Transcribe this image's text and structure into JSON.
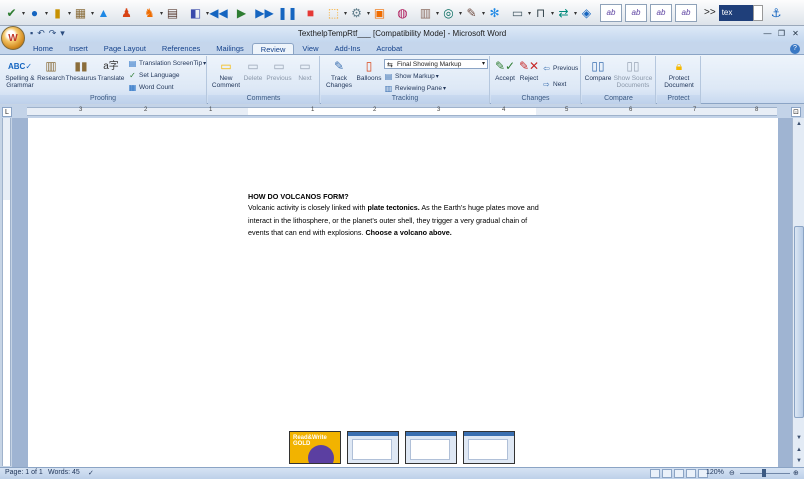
{
  "rw_toolbar": {
    "abc_buttons": [
      "ab",
      "ab",
      "ab",
      "ab"
    ],
    "more_label": ">>",
    "text_label": "tex"
  },
  "titlebar": {
    "title": "TexthelpTempRtf___ [Compatibility Mode] - Microsoft Word"
  },
  "tabs": [
    "Home",
    "Insert",
    "Page Layout",
    "References",
    "Mailings",
    "Review",
    "View",
    "Add-Ins",
    "Acrobat"
  ],
  "active_tab": "Review",
  "ribbon": {
    "proofing": {
      "label": "Proofing",
      "spelling": "Spelling &\nGrammar",
      "research": "Research",
      "thesaurus": "Thesaurus",
      "translate": "Translate",
      "translation_screentip": "Translation ScreenTip",
      "set_language": "Set Language",
      "word_count": "Word Count"
    },
    "comments": {
      "label": "Comments",
      "new_comment": "New\nComment",
      "delete": "Delete",
      "previous": "Previous",
      "next": "Next"
    },
    "tracking": {
      "label": "Tracking",
      "track_changes": "Track\nChanges",
      "balloons": "Balloons",
      "markup_select": "Final Showing Markup",
      "show_markup": "Show Markup",
      "reviewing_pane": "Reviewing Pane"
    },
    "changes": {
      "label": "Changes",
      "accept": "Accept",
      "reject": "Reject",
      "previous": "Previous",
      "next": "Next"
    },
    "compare": {
      "label": "Compare",
      "compare": "Compare",
      "show_source": "Show Source\nDocuments"
    },
    "protect": {
      "label": "Protect",
      "protect_document": "Protect\nDocument"
    }
  },
  "ruler": {
    "numbers": [
      "3",
      "2",
      "1",
      "1",
      "2",
      "3",
      "4",
      "5",
      "6",
      "7",
      "8",
      "9",
      "10",
      "11",
      "12"
    ]
  },
  "document": {
    "heading": "HOW DO VOLCANOS FORM?",
    "p1_a": "Volcanic activity is closely linked with ",
    "p1_bold": "plate tectonics.",
    "p1_b": " As the Earth’s huge plates move and interact in the lithosphere, or the planet’s outer shell, they trigger a very gradual chain of events that can end with explosions. ",
    "p1_bold2": "Choose a volcano above."
  },
  "thumbnails": {
    "rw_label": "Read&Write\nGOLD"
  },
  "statusbar": {
    "page": "Page: 1 of 1",
    "words": "Words: 45",
    "zoom": "120%"
  }
}
